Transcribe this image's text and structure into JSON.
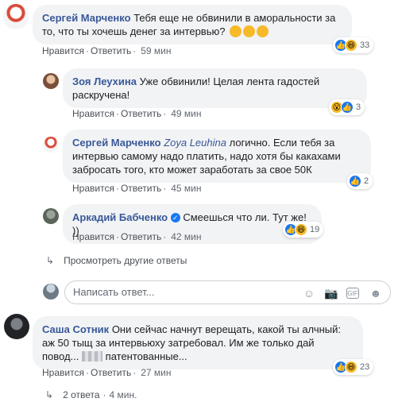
{
  "comments": [
    {
      "author": "Сергей Марченко",
      "text": "Тебя еще не обвинили в аморальности за то, что ты хочешь денег за интервью?",
      "like_label": "Нравится",
      "reply_label": "Ответить",
      "time": "59 мин",
      "reaction_count": "33"
    }
  ],
  "replies": [
    {
      "author": "Зоя Леухина",
      "text": "Уже обвинили! Целая лента гадостей раскручена!",
      "like_label": "Нравится",
      "reply_label": "Ответить",
      "time": "49 мин",
      "reaction_count": "3"
    },
    {
      "author": "Сергей Марченко",
      "mention": "Zoya Leuhina",
      "text": "логично. Если тебя за интервью самому надо платить, надо хотя бы какахами забросать того, кто может заработать за свое 50К",
      "like_label": "Нравится",
      "reply_label": "Ответить",
      "time": "45 мин",
      "reaction_count": "2"
    },
    {
      "author": "Аркадий Бабченко",
      "text": "Смеешься что ли. Тут же! ))",
      "like_label": "Нравится",
      "reply_label": "Ответить",
      "time": "42 мин",
      "reaction_count": "19"
    }
  ],
  "more_replies_label": "Просмотреть другие ответы",
  "reply_input": {
    "placeholder": "Написать ответ..."
  },
  "second_comment": {
    "author": "Саша Сотник",
    "text": "Они сейчас начнут верещать, какой ты алчный: аж 50 тыщ за интервьюху затребовал. Им же только дай повод...",
    "text_tail": "патентованные...",
    "like_label": "Нравится",
    "reply_label": "Ответить",
    "time": "27 мин",
    "reaction_count": "23"
  },
  "replies_summary": {
    "count_label": "2 ответа",
    "time": "4 мин."
  },
  "colors": {
    "link": "#385898",
    "bubble": "#f2f3f5",
    "like_blue": "#1877f2",
    "haha_yellow": "#f7b928"
  }
}
